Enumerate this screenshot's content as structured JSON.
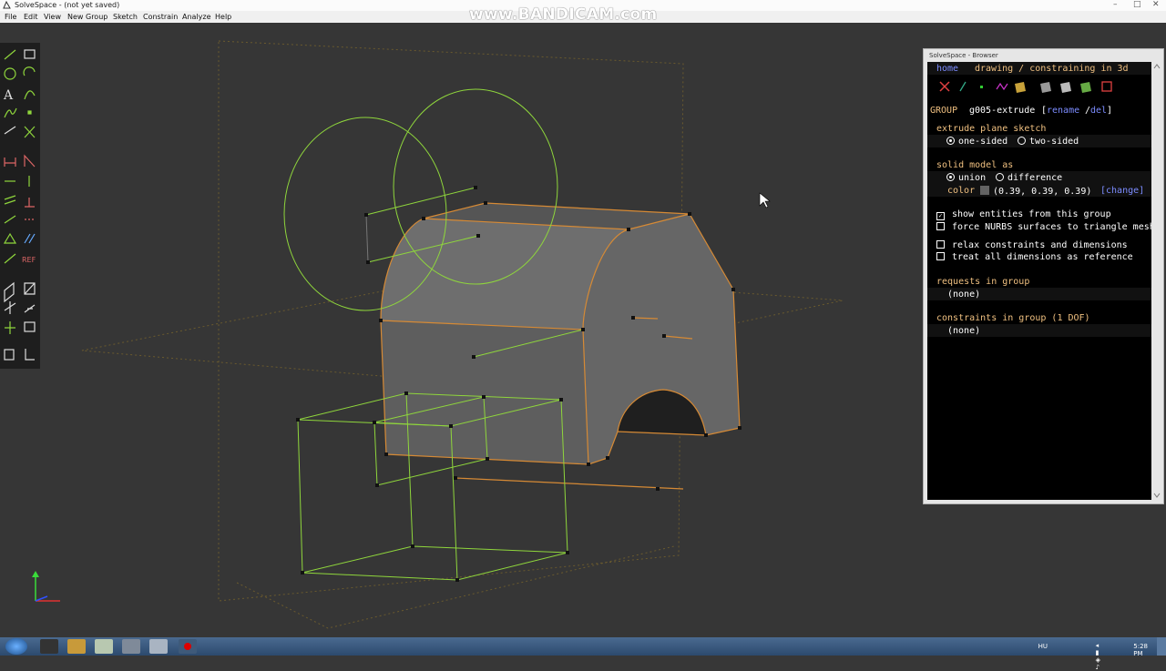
{
  "window": {
    "title": "SolveSpace - (not yet saved)"
  },
  "menu": [
    "File",
    "Edit",
    "View",
    "New Group",
    "Sketch",
    "Constrain",
    "Analyze",
    "Help"
  ],
  "watermark": "www.BANDICAM.com",
  "browser": {
    "window_title": "SolveSpace - Browser",
    "nav_home": "home",
    "nav_title": "drawing / constraining in 3d",
    "group_label": "GROUP",
    "group_name": "g005-extrude",
    "rename_open": "[",
    "rename": "rename",
    "slash": "/",
    "del": "del",
    "rename_close": "]",
    "extrude_heading": "extrude plane sketch",
    "one_sided": "one-sided",
    "two_sided": "two-sided",
    "solid_heading": "solid model as",
    "union": "union",
    "difference": "difference",
    "color_label": "color",
    "color_value": "(0.39, 0.39, 0.39)",
    "change": "[change]",
    "show_entities": "show entities from this group",
    "force_nurbs": "force NURBS surfaces to triangle mesh",
    "relax": "relax constraints and dimensions",
    "treat_ref": "treat all dimensions as reference",
    "requests_heading": "requests in group",
    "requests_none": "(none)",
    "constraints_heading": "constraints in group (1 DOF)",
    "constraints_none": "(none)"
  },
  "toolbar_icons": [
    "line-icon",
    "rectangle-icon",
    "circle-icon",
    "arc-icon",
    "text-icon",
    "tangent-arc-icon",
    "bezier-icon",
    "point-icon",
    "workplane-icon",
    "split-icon",
    "distance-icon",
    "angle-icon",
    "horizontal-icon",
    "vertical-icon",
    "parallel-icon",
    "perpendicular-icon",
    "on-entity-icon",
    "symmetric-icon",
    "equal-icon",
    "midpoint-icon",
    "reference-icon",
    "extrude-icon",
    "lathe-icon",
    "step-translate-icon",
    "step-rotate-icon",
    "assemble-icon",
    "sketch-in-3d-icon",
    "nearest-iso-icon",
    "nearest-ortho-icon"
  ],
  "tray": {
    "lang": "HU",
    "time": "5:28 PM"
  },
  "colors": {
    "viewport": "#363636",
    "sketch_green": "#8fd63c",
    "edge_orange": "#d68a35",
    "solid_gray": "#636363",
    "link": "#7c8cff"
  }
}
